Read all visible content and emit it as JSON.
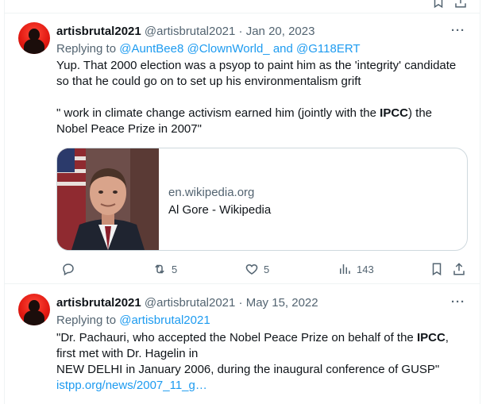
{
  "tweets": [
    {
      "name": "artisbrutal2021",
      "handle": "@artisbrutal2021",
      "dot": "·",
      "date": "Jan 20, 2023",
      "replying_prefix": "Replying to",
      "replying_to": "@AuntBee8 @ClownWorld_ and @G118ERT",
      "paragraph1": "Yup. That 2000 election was a psyop to paint him as the 'integrity' candidate so that he could go on to set up his environmentalism grift",
      "paragraph2_before": "\" work in climate change activism earned him (jointly with the ",
      "paragraph2_bold": "IPCC",
      "paragraph2_after": ") the Nobel Peace Prize in 2007\"",
      "card": {
        "domain": "en.wikipedia.org",
        "title": "Al Gore - Wikipedia"
      },
      "actions": {
        "retweets": "5",
        "likes": "5",
        "views": "143"
      }
    },
    {
      "name": "artisbrutal2021",
      "handle": "@artisbrutal2021",
      "dot": "·",
      "date": "May 15, 2022",
      "replying_prefix": "Replying to",
      "replying_to": "@artisbrutal2021",
      "line1_before": "\"Dr. Pachauri, who accepted the Nobel Peace Prize on behalf of the ",
      "line1_bold": "IPCC",
      "line1_after": ",",
      "line2": "first met with Dr. Hagelin in",
      "line3": "NEW  DELHI in January 2006, during the inaugural conference of GUSP\"",
      "link": "istpp.org/news/2007_11_g…"
    }
  ],
  "more_label": "···",
  "icons": [
    "reply-icon",
    "retweet-icon",
    "like-icon",
    "views-icon",
    "bookmark-icon",
    "share-icon",
    "more-icon"
  ],
  "colors": {
    "accent": "#1d9bf0",
    "secondary_text": "#536471",
    "border": "#eff3f4"
  }
}
